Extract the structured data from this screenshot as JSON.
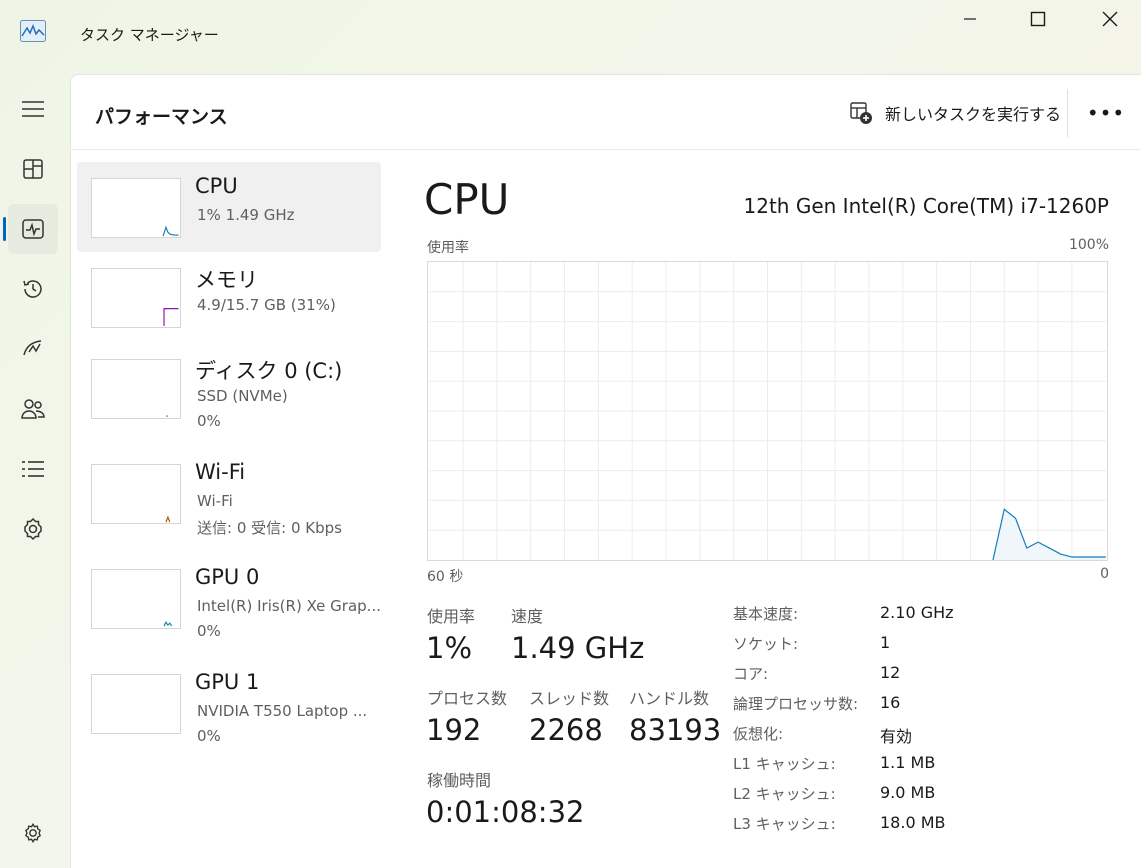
{
  "window": {
    "title": "タスク マネージャー",
    "icon": "task-manager-icon",
    "controls": [
      "minimize-icon",
      "maximize-icon",
      "close-icon"
    ]
  },
  "nav": {
    "items": [
      {
        "icon": "hamburger-icon"
      },
      {
        "icon": "processes-icon"
      },
      {
        "icon": "performance-icon",
        "active": true
      },
      {
        "icon": "history-icon"
      },
      {
        "icon": "startup-icon"
      },
      {
        "icon": "users-icon"
      },
      {
        "icon": "details-icon"
      },
      {
        "icon": "services-icon"
      },
      {
        "icon": "settings-icon"
      }
    ]
  },
  "header": {
    "title": "パフォーマンス",
    "new_task_label": "新しいタスクを実行する",
    "more_label": "•••"
  },
  "resources": [
    {
      "name": "CPU",
      "line1": "1%  1.49 GHz",
      "line2": "",
      "color": "#117dbb",
      "selected": true
    },
    {
      "name": "メモリ",
      "line1": "4.9/15.7 GB (31%)",
      "line2": "",
      "color": "#8b12ae"
    },
    {
      "name": "ディスク 0 (C:)",
      "line1": "SSD (NVMe)",
      "line2": "0%",
      "color": "#4da60c"
    },
    {
      "name": "Wi-Fi",
      "line1": "Wi-Fi",
      "line2": "送信: 0  受信: 0 Kbps",
      "color": "#a74f01"
    },
    {
      "name": "GPU 0",
      "line1": "Intel(R) Iris(R) Xe Grap...",
      "line2": "0%",
      "color": "#0e8a9e"
    },
    {
      "name": "GPU 1",
      "line1": "NVIDIA T550 Laptop ...",
      "line2": "0%",
      "color": "#0e8a9e"
    }
  ],
  "detail": {
    "title": "CPU",
    "model": "12th Gen Intel(R) Core(TM) i7-1260P",
    "graph_label": "使用率",
    "graph_max": "100%",
    "graph_time": "60 秒",
    "graph_min": "0",
    "line_color": "#117dbb",
    "fill_color": "#f1f6fa",
    "usage_label": "使用率",
    "usage_value": "1%",
    "speed_label": "速度",
    "speed_value": "1.49 GHz",
    "processes_label": "プロセス数",
    "processes_value": "192",
    "threads_label": "スレッド数",
    "threads_value": "2268",
    "handles_label": "ハンドル数",
    "handles_value": "83193",
    "uptime_label": "稼働時間",
    "uptime_value": "0:01:08:32",
    "info": [
      {
        "label": "基本速度:",
        "value": "2.10 GHz"
      },
      {
        "label": "ソケット:",
        "value": "1"
      },
      {
        "label": "コア:",
        "value": "12"
      },
      {
        "label": "論理プロセッサ数:",
        "value": "16"
      },
      {
        "label": "仮想化:",
        "value": "有効"
      },
      {
        "label": "L1 キャッシュ:",
        "value": "1.1 MB"
      },
      {
        "label": "L2 キャッシュ:",
        "value": "9.0 MB"
      },
      {
        "label": "L3 キャッシュ:",
        "value": "18.0 MB"
      }
    ]
  },
  "chart_data": {
    "type": "area",
    "title": "",
    "xlabel": "",
    "ylabel": "使用率",
    "xlim": [
      60,
      0
    ],
    "ylim": [
      0,
      100
    ],
    "grid": true,
    "series": [
      {
        "values_desc": "CPU usage over last 60 seconds (oldest to newest)",
        "x": [
          60,
          59,
          58,
          57,
          56,
          55,
          54,
          53,
          52,
          51,
          50,
          49,
          48,
          47,
          46,
          45,
          44,
          43,
          42,
          41,
          40,
          39,
          38,
          37,
          36,
          35,
          34,
          33,
          32,
          31,
          30,
          29,
          28,
          27,
          26,
          25,
          24,
          23,
          22,
          21,
          20,
          19,
          18,
          17,
          16,
          15,
          14,
          13,
          12,
          11,
          10,
          9,
          8,
          7,
          6,
          5,
          4,
          3,
          2,
          1,
          0
        ],
        "values": [
          null,
          null,
          null,
          null,
          null,
          null,
          null,
          null,
          null,
          null,
          null,
          null,
          null,
          null,
          null,
          null,
          null,
          null,
          null,
          null,
          null,
          null,
          null,
          null,
          null,
          null,
          null,
          null,
          null,
          null,
          null,
          null,
          null,
          null,
          null,
          null,
          null,
          null,
          null,
          null,
          null,
          null,
          null,
          null,
          null,
          null,
          null,
          null,
          null,
          null,
          0,
          17,
          14,
          4,
          6,
          4,
          2,
          1,
          1,
          1,
          1
        ]
      }
    ]
  }
}
